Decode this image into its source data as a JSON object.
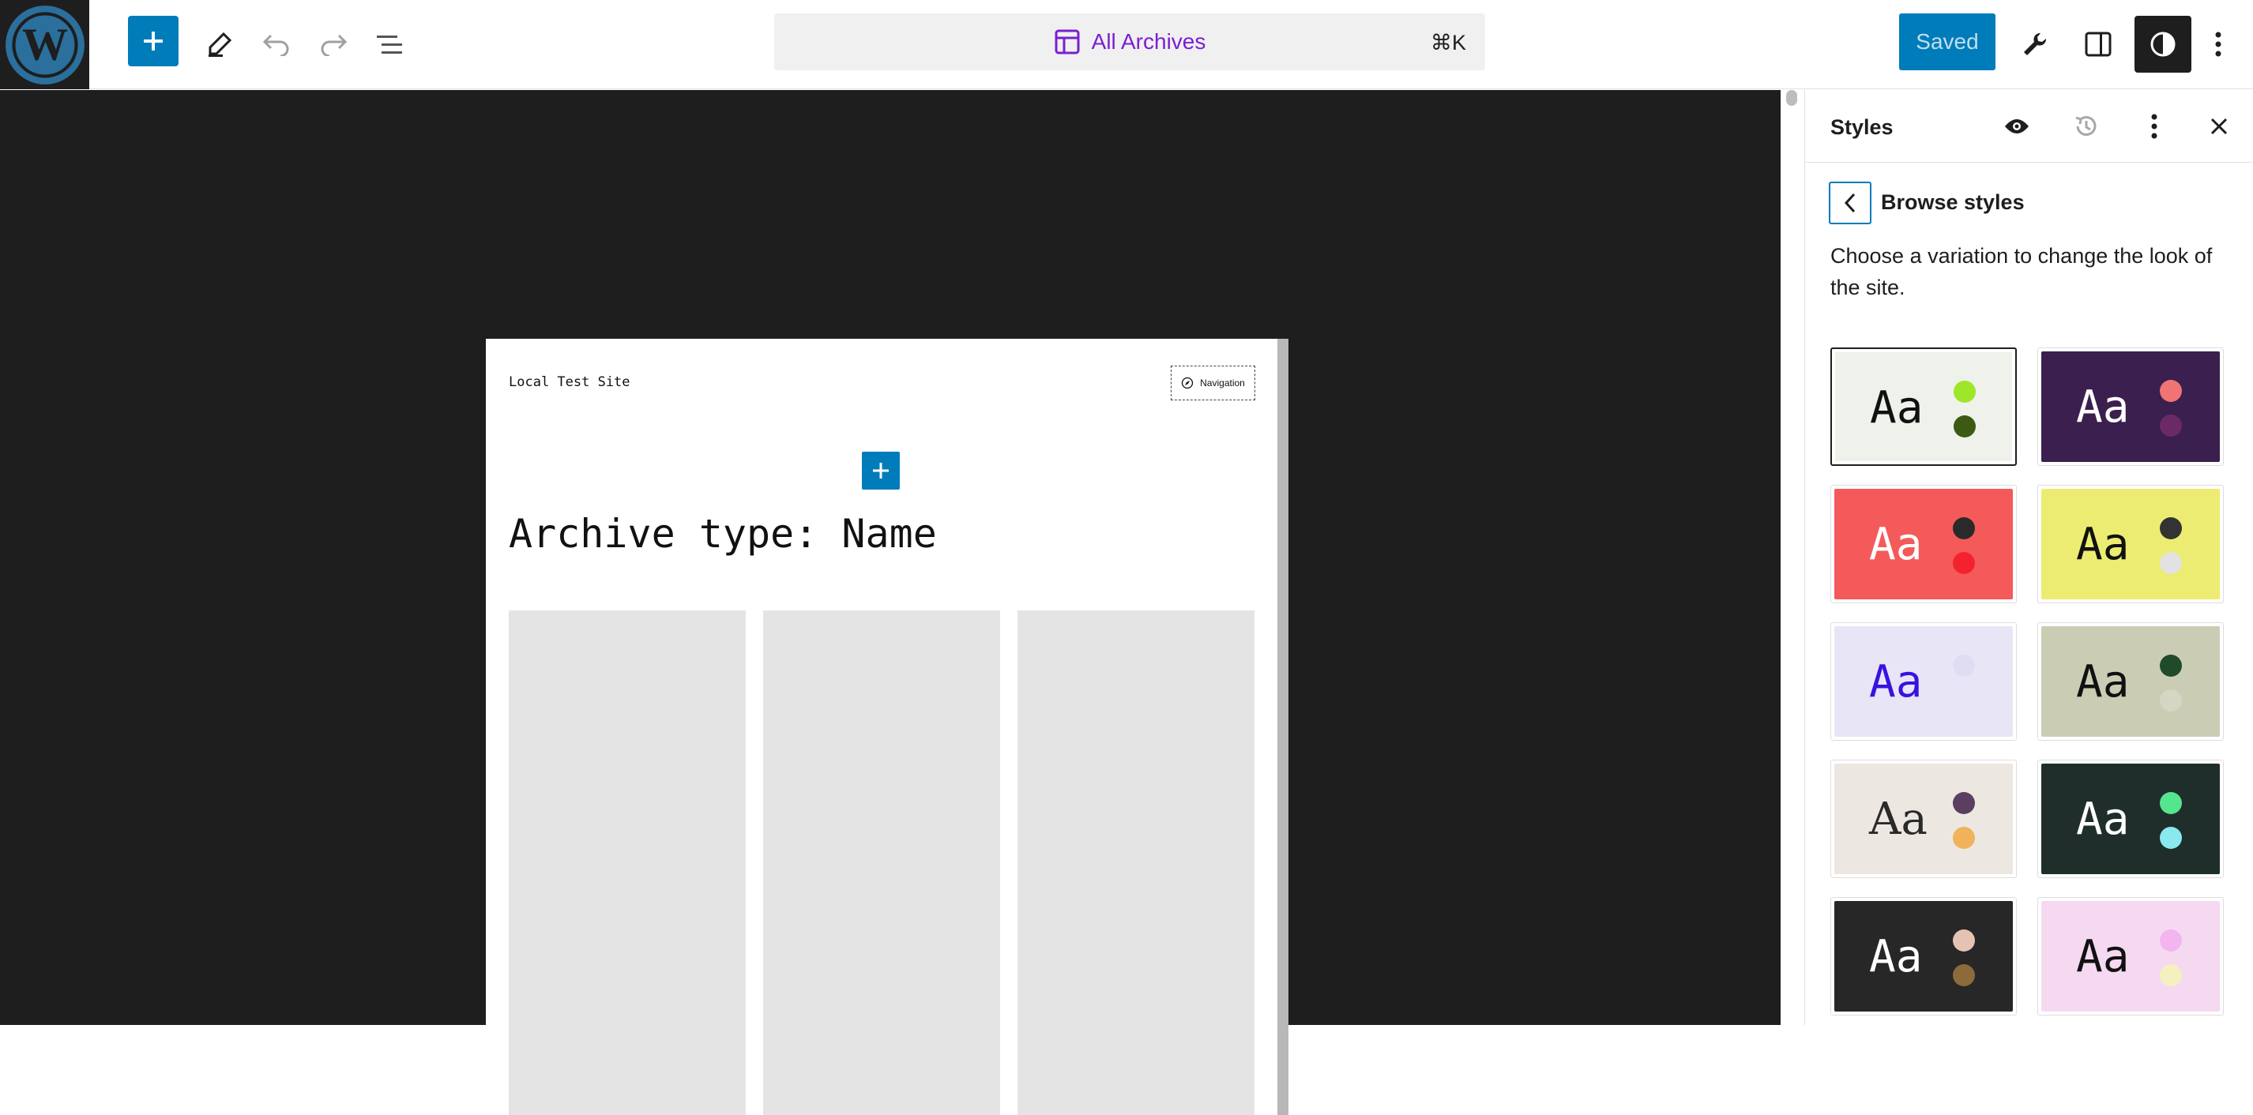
{
  "topbar": {
    "command": {
      "label": "All Archives",
      "shortcut": "⌘K"
    },
    "saved_label": "Saved"
  },
  "editor": {
    "site_title": "Local Test Site",
    "nav_label": "Navigation",
    "archive_title": "Archive type: Name"
  },
  "sidebar": {
    "title": "Styles",
    "browse_title": "Browse styles",
    "description": "Choose a variation to change the look of the site."
  },
  "variations": [
    {
      "bg": "#eef2ea",
      "text": "#111111",
      "dot1": "#9ee62a",
      "dot2": "#3d5a13",
      "serif": false,
      "active": true
    },
    {
      "bg": "#3b1f4e",
      "text": "#ffffff",
      "dot1": "#f07474",
      "dot2": "#6a2a66",
      "serif": false,
      "active": false
    },
    {
      "bg": "#f45a5a",
      "text": "#ffffff",
      "dot1": "#2a2a2a",
      "dot2": "#f4222f",
      "serif": false,
      "active": false
    },
    {
      "bg": "#ecec72",
      "text": "#111111",
      "dot1": "#333333",
      "dot2": "#e2e2e2",
      "serif": false,
      "active": false
    },
    {
      "bg": "#e8e6f6",
      "text": "#3a12e0",
      "dot1": "#e0ddf3",
      "dot2": "#e8e6f6",
      "serif": false,
      "active": false
    },
    {
      "bg": "#cbccb4",
      "text": "#111111",
      "dot1": "#1f4a2c",
      "dot2": "#d6d6c4",
      "serif": false,
      "active": false
    },
    {
      "bg": "#ece7e0",
      "text": "#2a2a2a",
      "dot1": "#5a3f61",
      "dot2": "#f0b25b",
      "serif": true,
      "active": false
    },
    {
      "bg": "#1f2e2a",
      "text": "#ffffff",
      "dot1": "#55e58f",
      "dot2": "#8ae9ef",
      "serif": false,
      "active": false
    },
    {
      "bg": "#272727",
      "text": "#ffffff",
      "dot1": "#e5c2b2",
      "dot2": "#8c6a3b",
      "serif": false,
      "active": false
    },
    {
      "bg": "#f5d9f0",
      "text": "#111111",
      "dot1": "#f2b5f0",
      "dot2": "#f4f0c0",
      "serif": false,
      "active": false
    }
  ],
  "colors": {
    "accent": "#007cba",
    "command_text": "#7b1fd1",
    "canvas_bg": "#1e1e1e"
  },
  "icons": [
    "wordpress-logo-icon",
    "plus-icon",
    "pen-icon",
    "undo-icon",
    "redo-icon",
    "list-view-icon",
    "template-icon",
    "wrench-icon",
    "sidebar-icon",
    "contrast-icon",
    "more-vertical-icon",
    "eye-icon",
    "history-icon",
    "close-icon",
    "chevron-left-icon",
    "compass-icon"
  ]
}
